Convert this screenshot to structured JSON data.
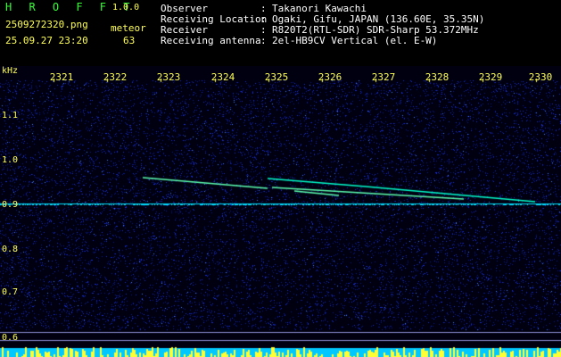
{
  "header": {
    "title": "H R O F F T",
    "version": "1.0.0",
    "filename": "2509272320.png",
    "meteor_label": "meteor",
    "datetime": "25.09.27 23:20",
    "meteor_count": "63"
  },
  "info": [
    {
      "key": "Observer",
      "value": "Takanori Kawachi"
    },
    {
      "key": "Receiving Location",
      "value": "Ogaki, Gifu, JAPAN (136.60E, 35.35N)"
    },
    {
      "key": "Receiver",
      "value": "R820T2(RTL-SDR) SDR-Sharp 53.372MHz"
    },
    {
      "key": "Receiving antenna",
      "value": "2el-HB9CV Vertical (el. E-W)"
    }
  ],
  "separator": ":",
  "axis": {
    "unit": "kHz",
    "x_ticks": [
      "2321",
      "2322",
      "2323",
      "2324",
      "2325",
      "2326",
      "2327",
      "2328",
      "2329",
      "2330"
    ],
    "y_ticks": [
      "1.1",
      "1.0",
      "0.9",
      "0.8",
      "0.7",
      "0.6"
    ]
  },
  "colors": {
    "label": "#ffff55",
    "info": "#ffffff",
    "title": "#33ff33",
    "background": "#000000",
    "noise": "#1a2fd0",
    "signal": "#00ffcc"
  }
}
